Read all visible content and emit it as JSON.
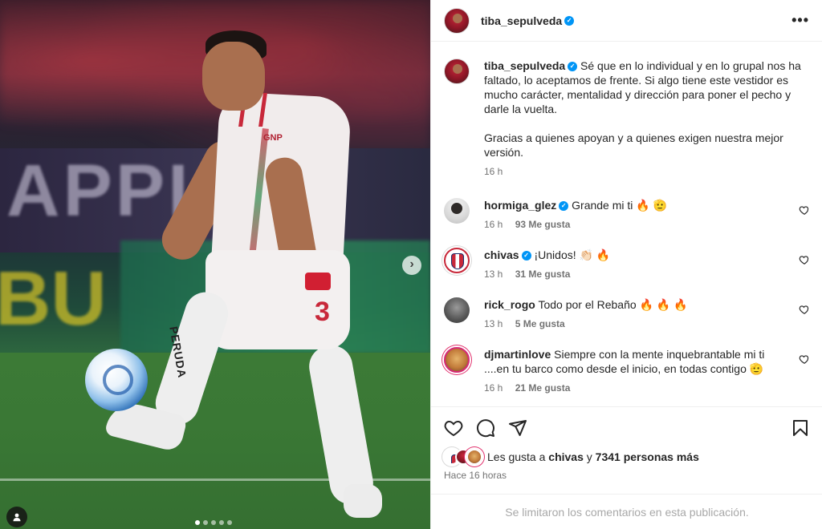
{
  "post": {
    "author": "tiba_sepulveda",
    "more_icon": "more-horizontal-icon",
    "media": {
      "carousel_dots": 5,
      "active_dot": 0,
      "next_icon": "chevron-right-icon",
      "tag_icon": "user-tag-icon",
      "sign_text_1": "APPIC",
      "sign_text_2": "BU",
      "sponsor": "GNP",
      "shirt_number": "3",
      "sock_text": "PERUDA"
    }
  },
  "caption": {
    "user": "tiba_sepulveda",
    "text_p1": "Sé que en lo individual y en lo grupal nos ha faltado, lo aceptamos de frente. Si algo tiene este vestidor es mucho carácter, mentalidad y dirección para poner el pecho y darle la vuelta.",
    "text_p2": "Gracias a quienes apoyan y a quienes exigen nuestra mejor versión.",
    "time": "16 h"
  },
  "comments": [
    {
      "user": "hormiga_glez",
      "verified": true,
      "text": "Grande mi ti 🔥 🫡",
      "time": "16 h",
      "likes": "93 Me gusta"
    },
    {
      "user": "chivas",
      "verified": true,
      "text": "¡Unidos! 👏🏻 🔥",
      "time": "13 h",
      "likes": "31 Me gusta"
    },
    {
      "user": "rick_rogo",
      "verified": false,
      "text": "Todo por el Rebaño 🔥 🔥 🔥",
      "time": "13 h",
      "likes": "5 Me gusta"
    },
    {
      "user": "djmartinlove",
      "verified": false,
      "text": "Siempre con la mente inquebrantable mi ti ....en tu barco como desde el inicio, en todas contigo 🫡",
      "time": "16 h",
      "likes": "21 Me gusta"
    }
  ],
  "actions": {
    "like_icon": "heart-icon",
    "comment_icon": "comment-icon",
    "share_icon": "send-icon",
    "save_icon": "bookmark-icon"
  },
  "likes": {
    "prefix": "Les gusta a",
    "user": "chivas",
    "conj": "y",
    "others": "7341 personas más"
  },
  "posted": "Hace 16 horas",
  "comments_limited": "Se limitaron los comentarios en esta publicación.",
  "colors": {
    "verified": "#0095f6",
    "muted": "#737373",
    "chivas_red": "#c8283a"
  }
}
